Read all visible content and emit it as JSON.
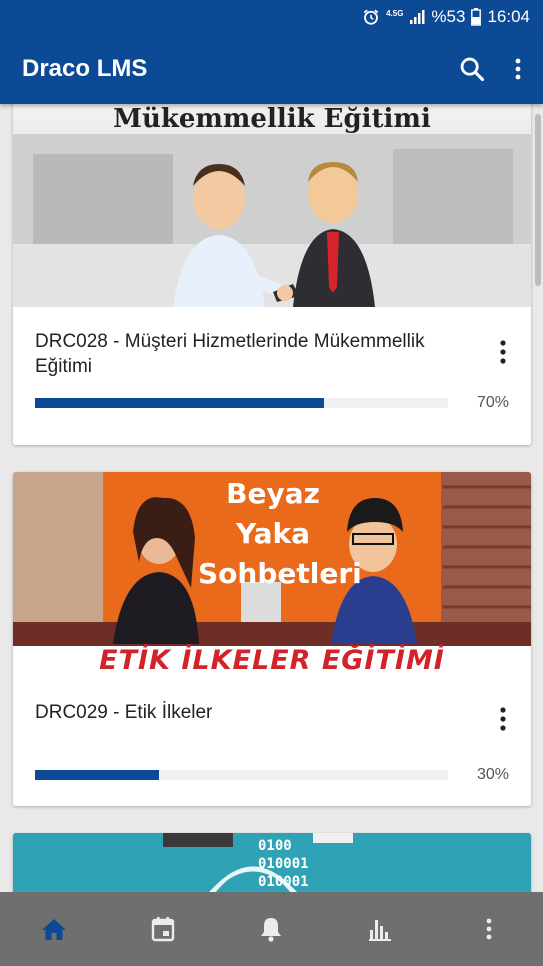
{
  "status_bar": {
    "network": "4.5G",
    "battery_percent": "%53",
    "time": "16:04",
    "icons": [
      "alarm-icon",
      "signal-icon",
      "battery-icon"
    ]
  },
  "app_bar": {
    "title": "Draco LMS",
    "actions": [
      "search-icon",
      "more-vert-icon"
    ]
  },
  "courses": [
    {
      "image_caption": "Mükemmellik Eğitimi",
      "title": "DRC028 - Müşteri Hizmetlerinde Mükemmellik Eğitimi",
      "progress": 70,
      "progress_label": "70%"
    },
    {
      "image_caption_top": "Beyaz Yaka Sohbetleri",
      "image_caption_bottom": "ETİK İLKELER EĞİTİMİ",
      "title": "DRC029 - Etik İlkeler",
      "progress": 30,
      "progress_label": "30%"
    },
    {
      "image_caption": "0100 010001 010001"
    }
  ],
  "bottom_nav": {
    "items": [
      "home-icon",
      "calendar-icon",
      "notifications-icon",
      "stats-icon",
      "more-vert-icon"
    ],
    "active": "home-icon",
    "colors": {
      "active": "#0d4a96",
      "inactive": "#e8e8e8"
    }
  },
  "colors": {
    "primary": "#0d4a96",
    "background": "#e9e9e9"
  }
}
